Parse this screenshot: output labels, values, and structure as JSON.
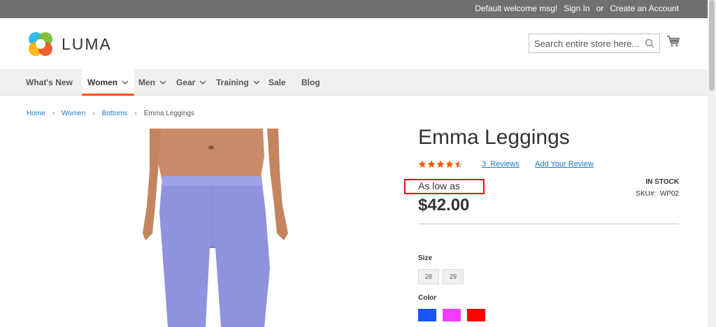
{
  "topbar": {
    "welcome": "Default welcome msg!",
    "sign_in": "Sign In",
    "or": "or",
    "create_account": "Create an Account"
  },
  "header": {
    "logo_text": "LUMA",
    "search_placeholder": "Search entire store here..."
  },
  "nav": {
    "items": [
      {
        "label": "What's New"
      },
      {
        "label": "Women"
      },
      {
        "label": "Men"
      },
      {
        "label": "Gear"
      },
      {
        "label": "Training"
      },
      {
        "label": "Sale"
      },
      {
        "label": "Blog"
      }
    ],
    "active": "Women"
  },
  "breadcrumb": {
    "items": [
      "Home",
      "Women",
      "Bottoms"
    ],
    "current": "Emma Leggings"
  },
  "product": {
    "name": "Emma Leggings",
    "rating": 4.5,
    "review_count": "3",
    "reviews_label": "Reviews",
    "add_review": "Add Your Review",
    "price_label": "As low as",
    "price": "$42.00",
    "stock": "In stock",
    "sku_label": "SKU#:",
    "sku": "WP02",
    "size_label": "Size",
    "sizes": [
      "28",
      "29"
    ],
    "color_label": "Color",
    "colors": [
      "#1857f7",
      "#ef3dff",
      "#ff0000"
    ]
  },
  "theme": {
    "accent": "#ff5501",
    "link": "#1979c3",
    "star": "#ff5501",
    "highlight": "#e0101a"
  }
}
